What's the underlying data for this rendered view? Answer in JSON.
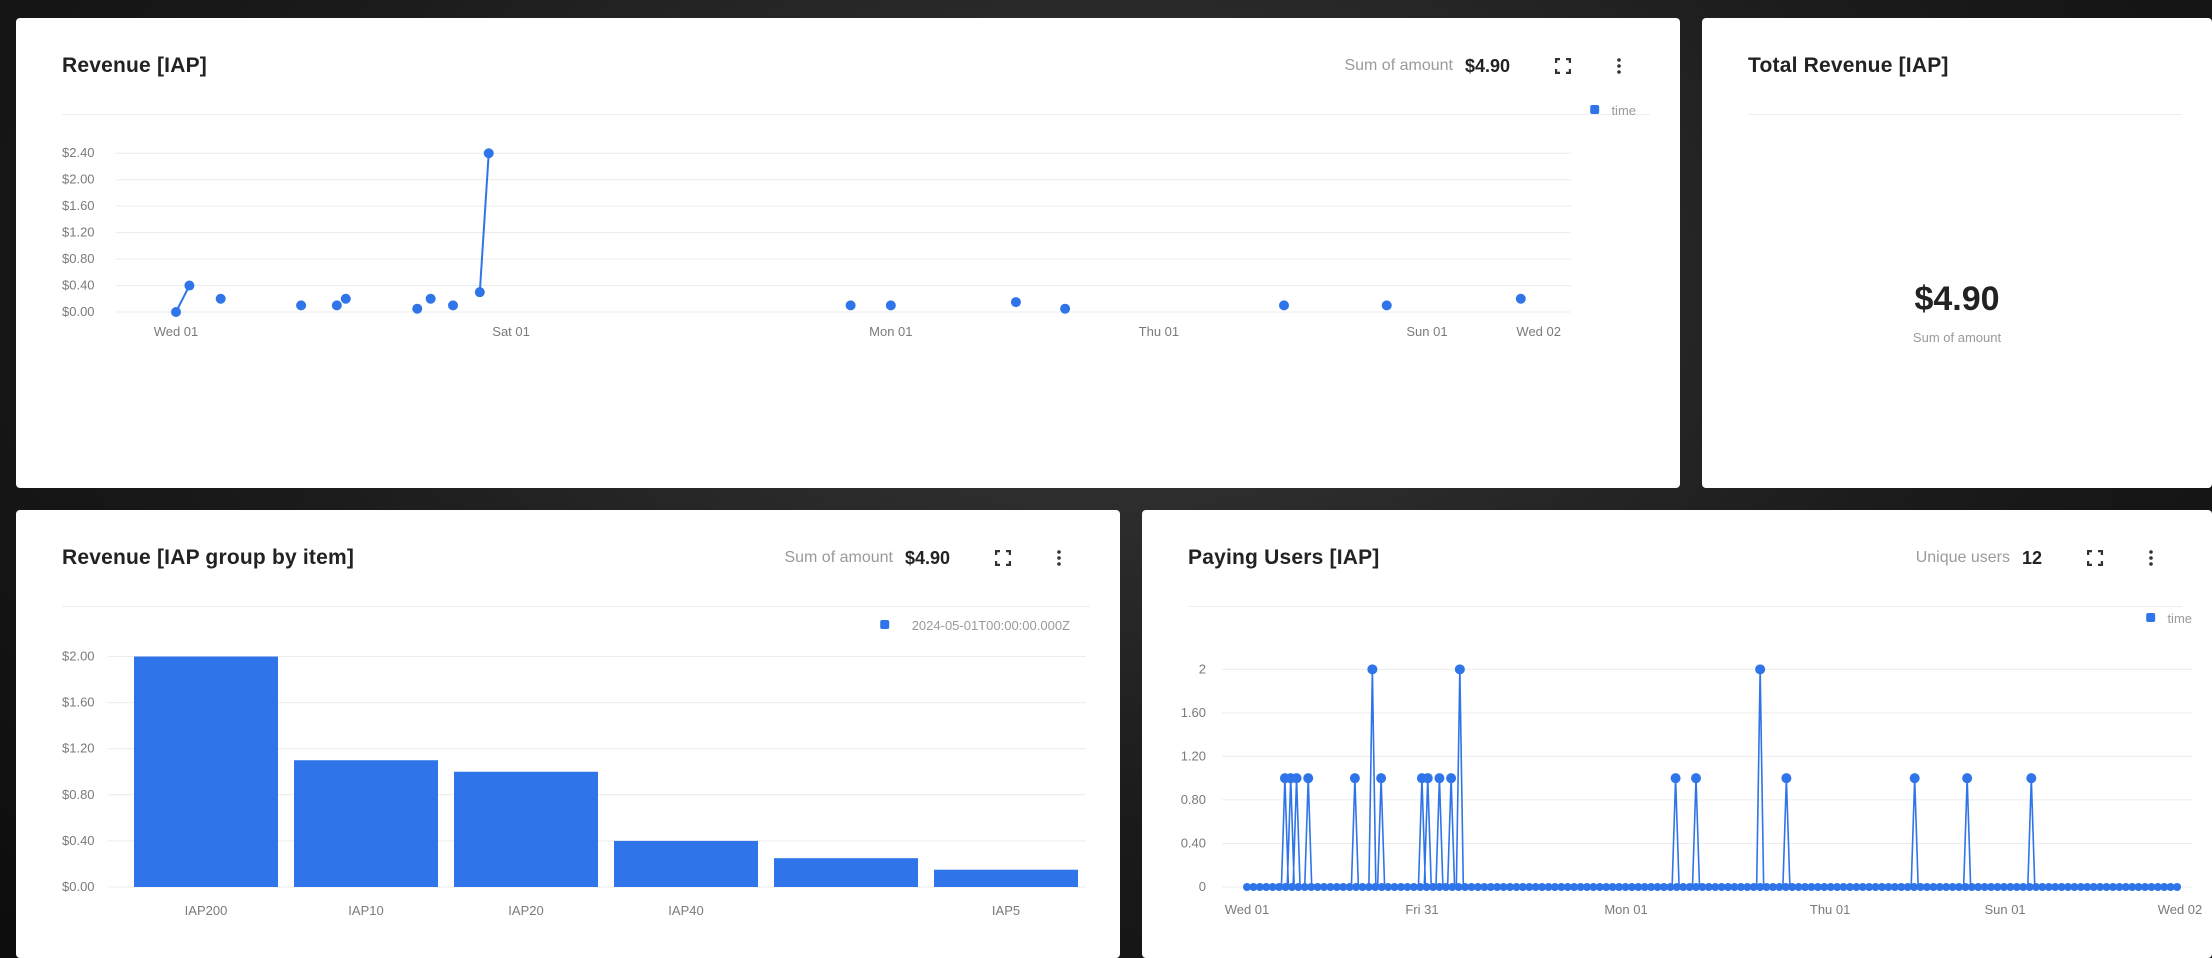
{
  "colors": {
    "series": "#2f74e8",
    "grid": "#ececec",
    "axis": "#7a7a7a"
  },
  "icons": {
    "expand": "expand-icon",
    "menu": "kebab-menu-icon"
  },
  "cards": {
    "revenue": {
      "title": "Revenue [IAP]",
      "agg_label": "Sum of amount",
      "agg_value": "$4.90"
    },
    "total": {
      "title": "Total Revenue [IAP]",
      "value": "$4.90",
      "value_label": "Sum of amount"
    },
    "item": {
      "title": "Revenue [IAP group by item]",
      "agg_label": "Sum of amount",
      "agg_value": "$4.90"
    },
    "users": {
      "title": "Paying Users [IAP]",
      "agg_label": "Unique users",
      "agg_value": "12"
    }
  },
  "chart_data": [
    {
      "id": "revenue",
      "type": "scatter",
      "legend": "time",
      "legend_position": "top-right",
      "grid": true,
      "xlim": [
        0,
        31
      ],
      "ylim": [
        0,
        2.6
      ],
      "x_ticks": [
        {
          "value": 0,
          "label": "Wed 01"
        },
        {
          "value": 7.5,
          "label": "Sat 01"
        },
        {
          "value": 16,
          "label": "Mon 01"
        },
        {
          "value": 22,
          "label": "Thu 01"
        },
        {
          "value": 28,
          "label": "Sun 01"
        },
        {
          "value": 31,
          "label": "Wed 02"
        }
      ],
      "y_ticks": [
        {
          "value": 0,
          "label": "$0.00"
        },
        {
          "value": 0.4,
          "label": "$0.40"
        },
        {
          "value": 0.8,
          "label": "$0.80"
        },
        {
          "value": 1.2,
          "label": "$1.20"
        },
        {
          "value": 1.6,
          "label": "$1.60"
        },
        {
          "value": 2.0,
          "label": "$2.00"
        },
        {
          "value": 2.4,
          "label": "$2.40"
        }
      ],
      "points": [
        {
          "x": 0.0,
          "y": 0.0
        },
        {
          "x": 0.3,
          "y": 0.4
        },
        {
          "x": 1.0,
          "y": 0.2
        },
        {
          "x": 2.8,
          "y": 0.1
        },
        {
          "x": 3.6,
          "y": 0.1
        },
        {
          "x": 3.8,
          "y": 0.2
        },
        {
          "x": 5.4,
          "y": 0.05
        },
        {
          "x": 5.7,
          "y": 0.2
        },
        {
          "x": 6.2,
          "y": 0.1
        },
        {
          "x": 6.8,
          "y": 0.3
        },
        {
          "x": 7.0,
          "y": 2.4
        },
        {
          "x": 15.1,
          "y": 0.1
        },
        {
          "x": 16.0,
          "y": 0.1
        },
        {
          "x": 18.8,
          "y": 0.15
        },
        {
          "x": 19.9,
          "y": 0.05
        },
        {
          "x": 24.8,
          "y": 0.1
        },
        {
          "x": 27.1,
          "y": 0.1
        },
        {
          "x": 30.1,
          "y": 0.2
        }
      ],
      "line_segments": [
        [
          0,
          1
        ],
        [
          9,
          10
        ]
      ]
    },
    {
      "id": "item",
      "type": "bar",
      "legend": "2024-05-01T00:00:00.000Z",
      "legend_position": "top-right",
      "grid": true,
      "ylim": [
        0,
        2.1
      ],
      "categories": [
        "IAP200",
        "IAP10",
        "IAP20",
        "IAP40",
        "",
        "IAP5"
      ],
      "values": [
        2.0,
        1.1,
        1.0,
        0.4,
        0.25,
        0.15
      ],
      "y_ticks": [
        {
          "value": 0,
          "label": "$0.00"
        },
        {
          "value": 0.4,
          "label": "$0.40"
        },
        {
          "value": 0.8,
          "label": "$0.80"
        },
        {
          "value": 1.2,
          "label": "$1.20"
        },
        {
          "value": 1.6,
          "label": "$1.60"
        },
        {
          "value": 2.0,
          "label": "$2.00"
        }
      ]
    },
    {
      "id": "users",
      "type": "line",
      "legend": "time",
      "legend_position": "top-right",
      "grid": true,
      "xlim": [
        0,
        32
      ],
      "ylim": [
        0,
        2.15
      ],
      "x_ticks": [
        {
          "value": 0,
          "label": "Wed 01"
        },
        {
          "value": 6,
          "label": "Fri 31"
        },
        {
          "value": 13,
          "label": "Mon 01"
        },
        {
          "value": 20,
          "label": "Thu 01"
        },
        {
          "value": 26,
          "label": "Sun 01"
        },
        {
          "value": 32,
          "label": "Wed 02"
        }
      ],
      "y_ticks": [
        {
          "value": 0,
          "label": "0"
        },
        {
          "value": 0.4,
          "label": "0.40"
        },
        {
          "value": 0.8,
          "label": "0.80"
        },
        {
          "value": 1.2,
          "label": "1.20"
        },
        {
          "value": 1.6,
          "label": "1.60"
        },
        {
          "value": 2,
          "label": "2"
        }
      ],
      "spikes": [
        {
          "x": 1.3,
          "y": 1
        },
        {
          "x": 1.5,
          "y": 1
        },
        {
          "x": 1.7,
          "y": 1
        },
        {
          "x": 2.1,
          "y": 1
        },
        {
          "x": 3.7,
          "y": 1
        },
        {
          "x": 4.3,
          "y": 2
        },
        {
          "x": 4.6,
          "y": 1
        },
        {
          "x": 6.0,
          "y": 1
        },
        {
          "x": 6.2,
          "y": 1
        },
        {
          "x": 6.6,
          "y": 1
        },
        {
          "x": 7.0,
          "y": 1
        },
        {
          "x": 7.3,
          "y": 2
        },
        {
          "x": 14.7,
          "y": 1
        },
        {
          "x": 15.4,
          "y": 1
        },
        {
          "x": 17.6,
          "y": 2
        },
        {
          "x": 18.5,
          "y": 1
        },
        {
          "x": 22.9,
          "y": 1
        },
        {
          "x": 24.7,
          "y": 1
        },
        {
          "x": 26.9,
          "y": 1
        }
      ]
    }
  ]
}
